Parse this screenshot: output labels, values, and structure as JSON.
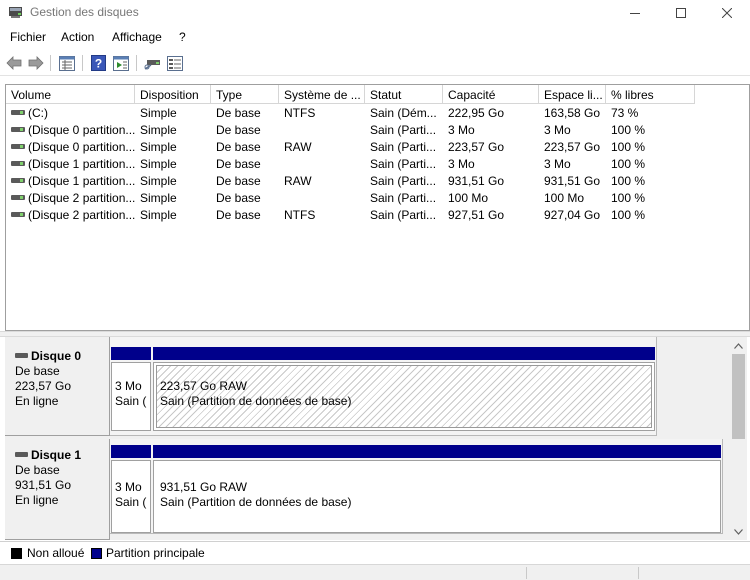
{
  "window": {
    "title": "Gestion des disques"
  },
  "menu": [
    "Fichier",
    "Action",
    "Affichage",
    "?"
  ],
  "toolbar_icons": [
    "back-arrow-icon",
    "forward-arrow-icon",
    "properties-grid-icon",
    "help-icon",
    "play-grid-icon",
    "rescan-icon",
    "volume-list-icon"
  ],
  "list": {
    "columns": [
      "Volume",
      "Disposition",
      "Type",
      "Système de ...",
      "Statut",
      "Capacité",
      "Espace li...",
      "% libres"
    ],
    "rows": [
      [
        "(C:)",
        "Simple",
        "De base",
        "NTFS",
        "Sain (Dém...",
        "222,95 Go",
        "163,58 Go",
        "73 %"
      ],
      [
        "(Disque 0 partition...",
        "Simple",
        "De base",
        "",
        "Sain (Parti...",
        "3 Mo",
        "3 Mo",
        "100 %"
      ],
      [
        "(Disque 0 partition...",
        "Simple",
        "De base",
        "RAW",
        "Sain (Parti...",
        "223,57 Go",
        "223,57 Go",
        "100 %"
      ],
      [
        "(Disque 1 partition...",
        "Simple",
        "De base",
        "",
        "Sain (Parti...",
        "3 Mo",
        "3 Mo",
        "100 %"
      ],
      [
        "(Disque 1 partition...",
        "Simple",
        "De base",
        "RAW",
        "Sain (Parti...",
        "931,51 Go",
        "931,51 Go",
        "100 %"
      ],
      [
        "(Disque 2 partition...",
        "Simple",
        "De base",
        "",
        "Sain (Parti...",
        "100 Mo",
        "100 Mo",
        "100 %"
      ],
      [
        "(Disque 2 partition...",
        "Simple",
        "De base",
        "NTFS",
        "Sain (Parti...",
        "927,51 Go",
        "927,04 Go",
        "100 %"
      ]
    ]
  },
  "disks": [
    {
      "name": "Disque 0",
      "type": "De base",
      "size": "223,57 Go",
      "status": "En ligne",
      "partitions": [
        {
          "line1": "3 Mo",
          "line2": "Sain ("
        },
        {
          "line1": "223,57 Go RAW",
          "line2": "Sain (Partition de données de base)"
        }
      ]
    },
    {
      "name": "Disque 1",
      "type": "De base",
      "size": "931,51 Go",
      "status": "En ligne",
      "partitions": [
        {
          "line1": "3 Mo",
          "line2": "Sain ("
        },
        {
          "line1": "931,51 Go RAW",
          "line2": "Sain (Partition de données de base)"
        }
      ]
    }
  ],
  "legend": [
    {
      "label": "Non alloué",
      "color": "#000000"
    },
    {
      "label": "Partition principale",
      "color": "#00008b"
    }
  ]
}
